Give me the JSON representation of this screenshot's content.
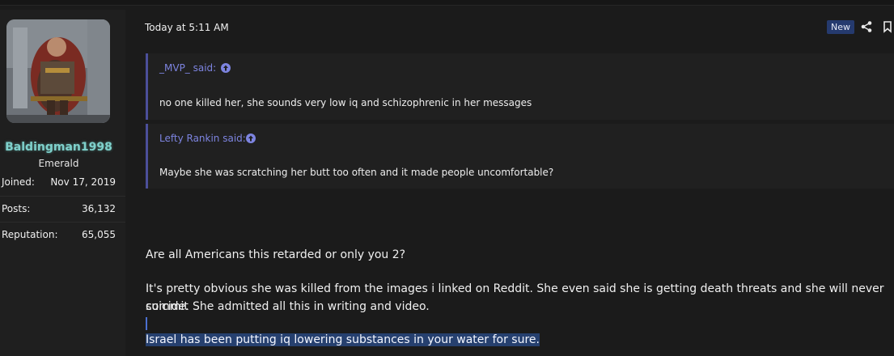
{
  "user": {
    "name": "Baldingman1998",
    "title": "Emerald",
    "stats": [
      {
        "label": "Joined:",
        "value": "Nov 17, 2019"
      },
      {
        "label": "Posts:",
        "value": "36,132"
      },
      {
        "label": "Reputation:",
        "value": "65,055"
      }
    ]
  },
  "post": {
    "date": "Today at 5:11 AM",
    "badge": "New",
    "actions": {
      "share_icon": "share-icon",
      "bookmark_icon": "bookmark-icon"
    },
    "quotes": [
      {
        "author": "_MVP_ said:",
        "text": "no one killed her, she sounds very low iq and schizophrenic in her messages"
      },
      {
        "author": "Lefty Rankin said:",
        "text": "Maybe she was scratching her butt too often and it made people uncomfortable?"
      }
    ],
    "paragraph1": "Are all Americans this retarded or only you 2?",
    "paragraph2_line1": "It's pretty obvious she was killed from the images i linked on Reddit. She even said she is getting death threats and she will never commit",
    "paragraph2_line2": "suicide. She admitted all this in writing and video.",
    "paragraph3": "Israel has been putting iq lowering substances in your water for sure."
  },
  "colors": {
    "accent": "#7d84e0",
    "badge": "#253a6e",
    "username": "#7fd1cc",
    "highlight": "#26406f"
  }
}
